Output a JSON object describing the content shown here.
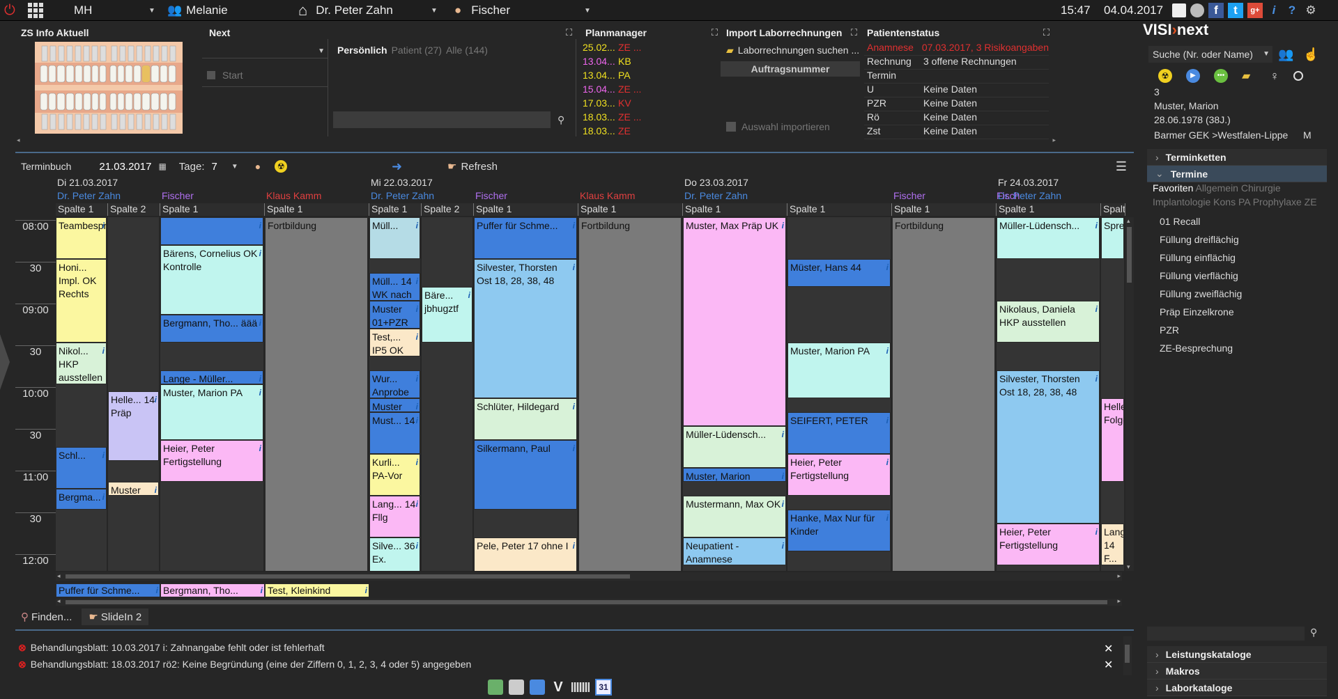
{
  "topbar": {
    "user_short": "MH",
    "user_name": "Melanie",
    "doctor": "Dr. Peter Zahn",
    "assistant": "Fischer",
    "time": "15:47",
    "date": "04.04.2017"
  },
  "panels": {
    "zs_info": "ZS Info Aktuell",
    "next": "Next",
    "start": "Start",
    "personal_tab": "Persönlich",
    "patient_tab": "Patient (27)",
    "all_tab": "Alle (144)",
    "planmanager": "Planmanager",
    "import_lab": "Import Laborrechnungen",
    "lab_search": "Laborrechnungen suchen ...",
    "order_number": "Auftragsnummer",
    "import_selection": "Auswahl importieren",
    "patient_status": "Patientenstatus"
  },
  "planmanager_rows": [
    {
      "date": "25.02...",
      "code": "ZE ...",
      "date_color": "#f0e020",
      "code_color": "#e03030"
    },
    {
      "date": "13.04...",
      "code": "KB",
      "date_color": "#ee66ee",
      "code_color": "#f0e020"
    },
    {
      "date": "13.04...",
      "code": "PA",
      "date_color": "#f0e020",
      "code_color": "#f0e020"
    },
    {
      "date": "15.04...",
      "code": "ZE ...",
      "date_color": "#ee66ee",
      "code_color": "#e03030"
    },
    {
      "date": "17.03...",
      "code": "KV",
      "date_color": "#f0e020",
      "code_color": "#e03030"
    },
    {
      "date": "18.03...",
      "code": "ZE ...",
      "date_color": "#f0e020",
      "code_color": "#e03030"
    },
    {
      "date": "18.03...",
      "code": "ZE",
      "date_color": "#f0e020",
      "code_color": "#e03030"
    }
  ],
  "patient_status_rows": [
    {
      "key": "Anamnese",
      "val": "07.03.2017, 3 Risikoangaben",
      "red": true
    },
    {
      "key": "Rechnung",
      "val": "3 offene Rechnungen",
      "red": false
    },
    {
      "key": "Termin",
      "val": "",
      "red": false
    },
    {
      "key": "U",
      "val": "Keine Daten",
      "red": false
    },
    {
      "key": "PZR",
      "val": "Keine Daten",
      "red": false
    },
    {
      "key": "Rö",
      "val": "Keine Daten",
      "red": false
    },
    {
      "key": "Zst",
      "val": "Keine Daten",
      "red": false
    }
  ],
  "calendar": {
    "book_label": "Terminbuch",
    "date": "21.03.2017",
    "days_label": "Tage:",
    "days_value": "7",
    "refresh": "Refresh",
    "times": [
      "08:00",
      "30",
      "09:00",
      "30",
      "10:00",
      "30",
      "11:00",
      "30",
      "12:00"
    ]
  },
  "days": [
    {
      "label": "Di 21.03.2017",
      "doctor": "Dr. Peter Zahn",
      "assistant": "Fischer",
      "other": "Klaus Kamm"
    },
    {
      "label": "Mi 22.03.2017",
      "doctor": "Dr. Peter Zahn",
      "assistant": "Fischer",
      "other": "Klaus Kamm"
    },
    {
      "label": "Do 23.03.2017",
      "doctor": "Dr. Peter Zahn",
      "assistant": "Fischer",
      "other": "Klaus Kamm"
    },
    {
      "label": "Fr 24.03.2017",
      "doctor": "Dr. Peter Zahn",
      "assistant": "Fisch"
    }
  ],
  "subcolumns": [
    "Spalte 1",
    "Spalte 2",
    "Spalte 1",
    "Spalte 1",
    "Spalte 1",
    "Spalte 2",
    "Spalte 1",
    "Spalte 1",
    "Spalte 1",
    "Spalte 1",
    "Spalte 1",
    "Spalte 1",
    "Spalt"
  ],
  "appointments": {
    "c0": [
      {
        "text": "Teambespr...",
        "color": "#fbf7a0",
        "start": 0,
        "end": 30,
        "info": "i"
      },
      {
        "text": "Honi... Impl. OK Rechts",
        "color": "#fbf7a0",
        "start": 30,
        "end": 90,
        "info": ""
      },
      {
        "text": "Nikol... HKP ausstellen",
        "color": "#d8f2d8",
        "start": 90,
        "end": 120,
        "info": "i"
      },
      {
        "text": "Schl...",
        "color": "#3f7fdc",
        "start": 165,
        "end": 195,
        "info": "i"
      },
      {
        "text": "Bergma...",
        "color": "#3f7fdc",
        "start": 195,
        "end": 210,
        "info": "i"
      }
    ],
    "c1": [
      {
        "text": "Helle... 14 Präp",
        "color": "#c9c4f5",
        "start": 125,
        "end": 175,
        "info": "i"
      },
      {
        "text": "Muster",
        "color": "#fbe8c8",
        "start": 190,
        "end": 200,
        "info": "i"
      }
    ],
    "c2": [
      {
        "text": "",
        "color": "#3f7fdc",
        "start": 0,
        "end": 20,
        "info": "i"
      },
      {
        "text": "Bärens, Cornelius OK Kontrolle",
        "color": "#c0f5ee",
        "start": 20,
        "end": 70,
        "info": "i"
      },
      {
        "text": "Bergmann, Tho... äää",
        "color": "#3f7fdc",
        "start": 70,
        "end": 90,
        "info": "i"
      },
      {
        "text": "Lange - Müller...",
        "color": "#3f7fdc",
        "start": 110,
        "end": 120,
        "info": "i"
      },
      {
        "text": "Muster, Marion PA",
        "color": "#c0f5ee",
        "start": 120,
        "end": 160,
        "info": "i"
      },
      {
        "text": "Heier, Peter Fertigstellung",
        "color": "#fbb8f5",
        "start": 160,
        "end": 190,
        "info": "i"
      }
    ],
    "c3": [
      {
        "text": "Fortbildung",
        "color": "#7a7a7a",
        "start": 0,
        "end": 260,
        "info": ""
      }
    ],
    "c4": [
      {
        "text": "Müll...",
        "color": "#b5dce6",
        "start": 0,
        "end": 30,
        "info": "i"
      },
      {
        "text": "Müll... 14 WK nach",
        "color": "#3f7fdc",
        "start": 40,
        "end": 60,
        "info": "i"
      },
      {
        "text": "Muster 01+PZR",
        "color": "#3f7fdc",
        "start": 60,
        "end": 80,
        "info": "i"
      },
      {
        "text": "Test,... IP5 OK",
        "color": "#fbe8c8",
        "start": 80,
        "end": 100,
        "info": "i"
      },
      {
        "text": "Wur... Anprobe OK",
        "color": "#3f7fdc",
        "start": 110,
        "end": 130,
        "info": "i"
      },
      {
        "text": "Muster",
        "color": "#3f7fdc",
        "start": 130,
        "end": 140,
        "info": "i"
      },
      {
        "text": "Must... 14",
        "color": "#3f7fdc",
        "start": 140,
        "end": 170,
        "info": "i"
      },
      {
        "text": "Kurli... PA-Vor",
        "color": "#fbf7a0",
        "start": 170,
        "end": 200,
        "info": "i"
      },
      {
        "text": "Lang... 14 Fllg",
        "color": "#fbb8f5",
        "start": 200,
        "end": 230,
        "info": "i"
      },
      {
        "text": "Silve... 36 Ex.",
        "color": "#c0f5ee",
        "start": 230,
        "end": 255,
        "info": "i"
      }
    ],
    "c5": [
      {
        "text": "Bäre... jbhugztf",
        "color": "#c0f5ee",
        "start": 50,
        "end": 90,
        "info": "i"
      }
    ],
    "c6": [
      {
        "text": "Puffer für Schme...",
        "color": "#3f7fdc",
        "start": 0,
        "end": 30,
        "info": "i"
      },
      {
        "text": "Silvester, Thorsten Ost 18, 28, 38, 48",
        "color": "#8ec9f0",
        "start": 30,
        "end": 130,
        "info": "i"
      },
      {
        "text": "Schlüter, Hildegard",
        "color": "#d8f2d8",
        "start": 130,
        "end": 160,
        "info": "i"
      },
      {
        "text": "Silkermann, Paul",
        "color": "#3f7fdc",
        "start": 160,
        "end": 210,
        "info": "i"
      },
      {
        "text": "Pele, Peter 17 ohne I",
        "color": "#fbe8c8",
        "start": 230,
        "end": 260,
        "info": "i"
      }
    ],
    "c7": [
      {
        "text": "Fortbildung",
        "color": "#7a7a7a",
        "start": 0,
        "end": 260,
        "info": ""
      }
    ],
    "c8": [
      {
        "text": "Muster, Max Präp UK",
        "color": "#fbb8f5",
        "start": 0,
        "end": 150,
        "info": "i"
      },
      {
        "text": "Müller-Lüdensch...",
        "color": "#d8f2d8",
        "start": 150,
        "end": 180,
        "info": "i"
      },
      {
        "text": "Muster, Marion",
        "color": "#3f7fdc",
        "start": 180,
        "end": 190,
        "info": "i"
      },
      {
        "text": "Mustermann, Max OK",
        "color": "#d8f2d8",
        "start": 200,
        "end": 230,
        "info": "i"
      },
      {
        "text": "Neupatient - Anamnese",
        "color": "#8ec9f0",
        "start": 230,
        "end": 250,
        "info": "i"
      }
    ],
    "c9": [
      {
        "text": "Müster, Hans 44",
        "color": "#3f7fdc",
        "start": 30,
        "end": 50,
        "info": "i"
      },
      {
        "text": "Muster, Marion PA",
        "color": "#c0f5ee",
        "start": 90,
        "end": 130,
        "info": "i"
      },
      {
        "text": "SEIFERT, PETER",
        "color": "#3f7fdc",
        "start": 140,
        "end": 170,
        "info": "i"
      },
      {
        "text": "Heier, Peter Fertigstellung",
        "color": "#fbb8f5",
        "start": 170,
        "end": 200,
        "info": "i"
      },
      {
        "text": "Hanke, Max Nur für Kinder",
        "color": "#3f7fdc",
        "start": 210,
        "end": 240,
        "info": "i"
      }
    ],
    "c10": [
      {
        "text": "Fortbildung",
        "color": "#7a7a7a",
        "start": 0,
        "end": 260,
        "info": ""
      }
    ],
    "c11": [
      {
        "text": "Müller-Lüdensch...",
        "color": "#c0f5ee",
        "start": 0,
        "end": 30,
        "info": "i"
      },
      {
        "text": "Nikolaus, Daniela HKP ausstellen",
        "color": "#d8f2d8",
        "start": 60,
        "end": 90,
        "info": "i"
      },
      {
        "text": "Silvester, Thorsten Ost 18, 28, 38, 48",
        "color": "#8ec9f0",
        "start": 110,
        "end": 220,
        "info": "i"
      },
      {
        "text": "Heier, Peter Fertigstellung",
        "color": "#fbb8f5",
        "start": 220,
        "end": 250,
        "info": "i"
      }
    ],
    "c12": [
      {
        "text": "Spre...",
        "color": "#c0f5ee",
        "start": 0,
        "end": 30,
        "info": ""
      },
      {
        "text": "Helle... Folge...",
        "color": "#fbb8f5",
        "start": 130,
        "end": 190,
        "info": ""
      },
      {
        "text": "Lang... 14 F...",
        "color": "#fbe8c8",
        "start": 220,
        "end": 250,
        "info": ""
      }
    ]
  },
  "waiting": [
    {
      "text": "Puffer für Schme...",
      "color": "#3f7fdc"
    },
    {
      "text": "Bergmann, Tho...",
      "color": "#fbb8f5"
    },
    {
      "text": "Test, Kleinkind",
      "color": "#fbf7a0"
    }
  ],
  "bottom_tabs": {
    "find": "Finden...",
    "slidein": "SlideIn 2"
  },
  "errors": [
    {
      "text": "Behandlungsblatt: 10.03.2017 i: Zahnangabe fehlt oder ist fehlerhaft"
    },
    {
      "text": "Behandlungsblatt: 18.03.2017 rö2: Keine Begründung (eine der Ziffern 0, 1, 2, 3, 4 oder 5) angegeben"
    }
  ],
  "right": {
    "logo": "VISI",
    "logo2": "next",
    "search_placeholder": "Suche (Nr. oder Name)",
    "patient_no": "3",
    "patient_name": "Muster, Marion",
    "patient_dob": "28.06.1978 (38J.)",
    "insurance": "Barmer GEK >Westfalen-Lippe",
    "gender": "M",
    "terminketten": "Terminketten",
    "termine": "Termine",
    "favoriten": "Favoriten",
    "tag_allgemein": "Allgemein",
    "tag_chirurgie": "Chirurgie",
    "tag_row2": "Implantologie Kons PA Prophylaxe ZE",
    "items": [
      "01 Recall",
      "Füllung dreiflächig",
      "Füllung einflächig",
      "Füllung vierflächig",
      "Füllung zweiflächig",
      "Präp Einzelkrone",
      "PZR",
      "ZE-Besprechung"
    ],
    "leistungskataloge": "Leistungskataloge",
    "makros": "Makros",
    "laborkataloge": "Laborkataloge"
  }
}
